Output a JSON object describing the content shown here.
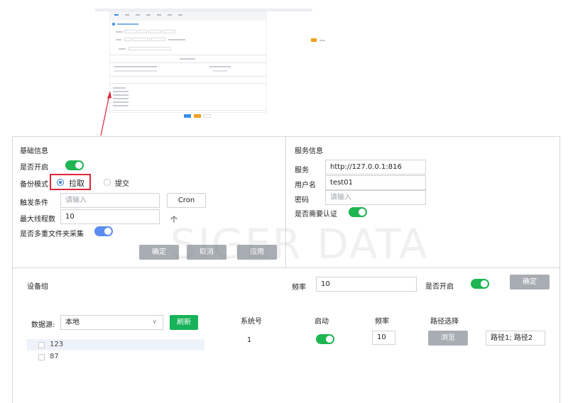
{
  "colors": {
    "accent": "#3a7bdc",
    "toggle_on": "#1fb552",
    "highlight": "#e0263a",
    "gray_button": "#a8adb3",
    "green_button": "#17b35a"
  },
  "watermark": "SIGER DATA",
  "basic": {
    "title": "基础信息",
    "enable_label": "是否开启",
    "enable_on": true,
    "mode_label": "备份模式",
    "mode_pull": "拉取",
    "mode_push": "提交",
    "trigger_label": "触发条件",
    "trigger_placeholder": "请输入",
    "cron_button": "Cron",
    "max_threads_label": "最大线程数",
    "max_threads_value": "10",
    "max_threads_unit": "个",
    "multi_folder_label": "是否多重文件夹采集",
    "confirm": "确定",
    "cancel": "取消",
    "apply": "应用"
  },
  "service": {
    "title": "服务信息",
    "service_label": "服务",
    "service_value": "http://127.0.0.1:816",
    "username_label": "用户名",
    "username_value": "test01",
    "password_label": "密码",
    "password_placeholder": "请输入",
    "auth_label": "是否需要认证"
  },
  "device": {
    "title": "设备组",
    "freq_label": "频率",
    "freq_value": "10",
    "enable_label": "是否开启",
    "confirm": "确定",
    "datasource_label": "数据源:",
    "datasource_value": "本地",
    "refresh": "刷新",
    "tree": [
      "123",
      "87"
    ],
    "columns": {
      "system": "系统号",
      "start": "启动",
      "freq": "频率",
      "path": "路径选择"
    },
    "row": {
      "system": "1",
      "freq": "10",
      "browse": "浏览",
      "paths": "路径1; 路径2"
    }
  }
}
